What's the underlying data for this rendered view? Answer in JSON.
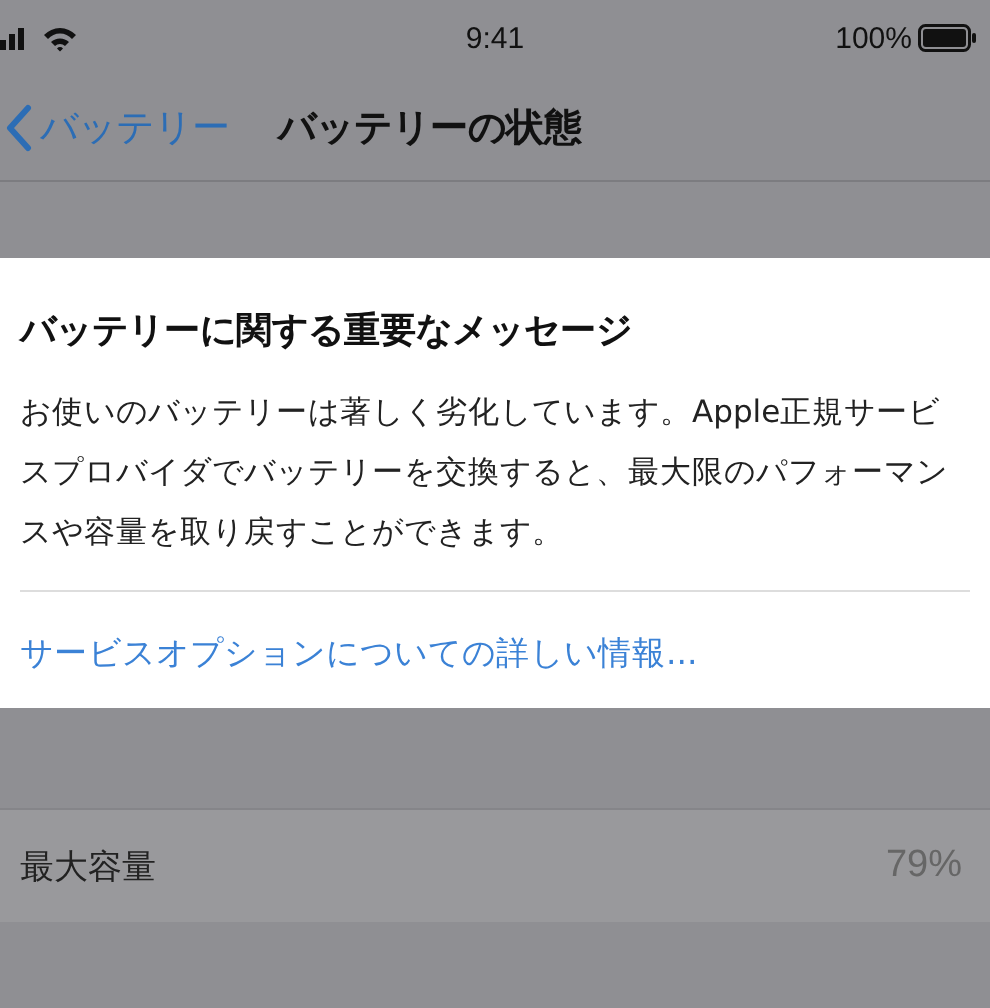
{
  "status_bar": {
    "time": "9:41",
    "battery": "100%"
  },
  "nav": {
    "back": "バッテリー",
    "title": "バッテリーの状態"
  },
  "alert": {
    "title": "バッテリーに関する重要なメッセージ",
    "message": "お使いのバッテリーは著しく劣化しています。Apple正規サービスプロバイダでバッテリーを交換すると、最大限のパフォーマンスや容量を取り戻すことができます。",
    "link": "サービスオプションについての詳しい情報..."
  },
  "rows": [
    {
      "label": "最大容量",
      "value": "79%"
    }
  ]
}
